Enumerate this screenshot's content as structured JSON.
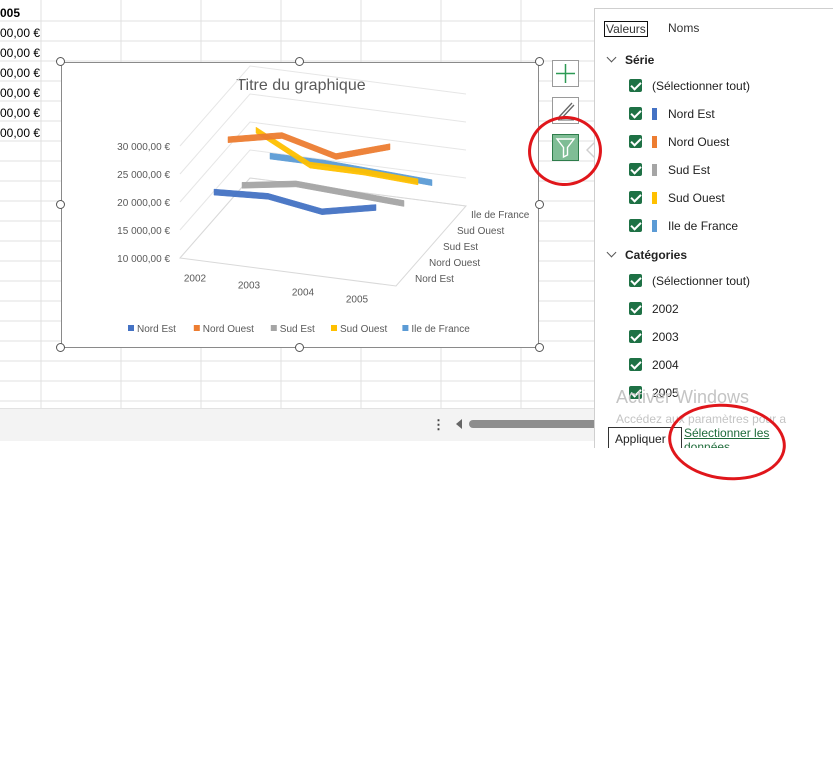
{
  "sheet": {
    "header_cell": "005",
    "currency_cells": [
      "00,00 €",
      "00,00 €",
      "00,00 €",
      "00,00 €",
      "00,00 €",
      "00,00 €"
    ]
  },
  "chart": {
    "title": "Titre du graphique",
    "legend": [
      "Nord Est",
      "Nord Ouest",
      "Sud Est",
      "Sud Ouest",
      "Ile de France"
    ],
    "series_colors": [
      "#4472c4",
      "#ed7d31",
      "#a5a5a5",
      "#ffc000",
      "#5b9bd5"
    ]
  },
  "chart_data": {
    "type": "line",
    "title": "Titre du graphique",
    "categories": [
      "2002",
      "2003",
      "2004",
      "2005"
    ],
    "y_tick_labels": [
      "10 000,00 €",
      "15 000,00 €",
      "20 000,00 €",
      "25 000,00 €",
      "30 000,00 €"
    ],
    "depth_labels": [
      "Nord Est",
      "Nord Ouest",
      "Sud Est",
      "Sud Ouest",
      "Ile de France"
    ],
    "series": [
      {
        "name": "Nord Est",
        "values": [
          21500,
          22000,
          20500,
          22500
        ]
      },
      {
        "name": "Nord Ouest",
        "values": [
          28000,
          30000,
          27500,
          30500
        ]
      },
      {
        "name": "Sud Est",
        "values": [
          17000,
          18500,
          18000,
          17500
        ]
      },
      {
        "name": "Sud Ouest",
        "values": [
          24000,
          19000,
          19000,
          18500
        ]
      },
      {
        "name": "Ile de France",
        "values": [
          16500,
          16500,
          16000,
          15500
        ]
      }
    ],
    "ylim": [
      10000,
      30000
    ],
    "style": "3d-line",
    "legend_position": "bottom"
  },
  "filter_panel": {
    "tab_values": "Valeurs",
    "tab_names": "Noms",
    "series_header": "Série",
    "series_items": [
      "(Sélectionner tout)",
      "Nord Est",
      "Nord Ouest",
      "Sud Est",
      "Sud Ouest",
      "Ile de France"
    ],
    "categories_header": "Catégories",
    "category_items": [
      "(Sélectionner tout)",
      "2002",
      "2003",
      "2004",
      "2005"
    ],
    "apply_label": "Appliquer",
    "select_data_link": "Sélectionner les données"
  },
  "watermark": {
    "title": "Activer Windows",
    "subtitle": "Accédez aux paramètres pour a"
  }
}
